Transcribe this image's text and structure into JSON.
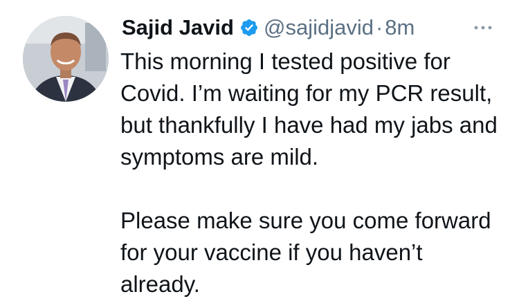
{
  "tweet": {
    "author": {
      "display_name": "Sajid Javid",
      "handle": "@sajidjavid",
      "verified": true,
      "avatar_icon": "profile-photo"
    },
    "separator": "·",
    "timestamp": "8m",
    "more_icon": "more-horizontal-icon",
    "paragraphs": [
      "This morning I tested positive for Covid. I’m waiting for my PCR result, but thankfully I have had my jabs and symptoms are mild.",
      "Please make sure you come forward for your vaccine if you haven’t already."
    ]
  },
  "colors": {
    "text": "#0f1419",
    "secondary": "#5b7083",
    "verified_badge": "#1d9bf0",
    "background": "#ffffff"
  }
}
